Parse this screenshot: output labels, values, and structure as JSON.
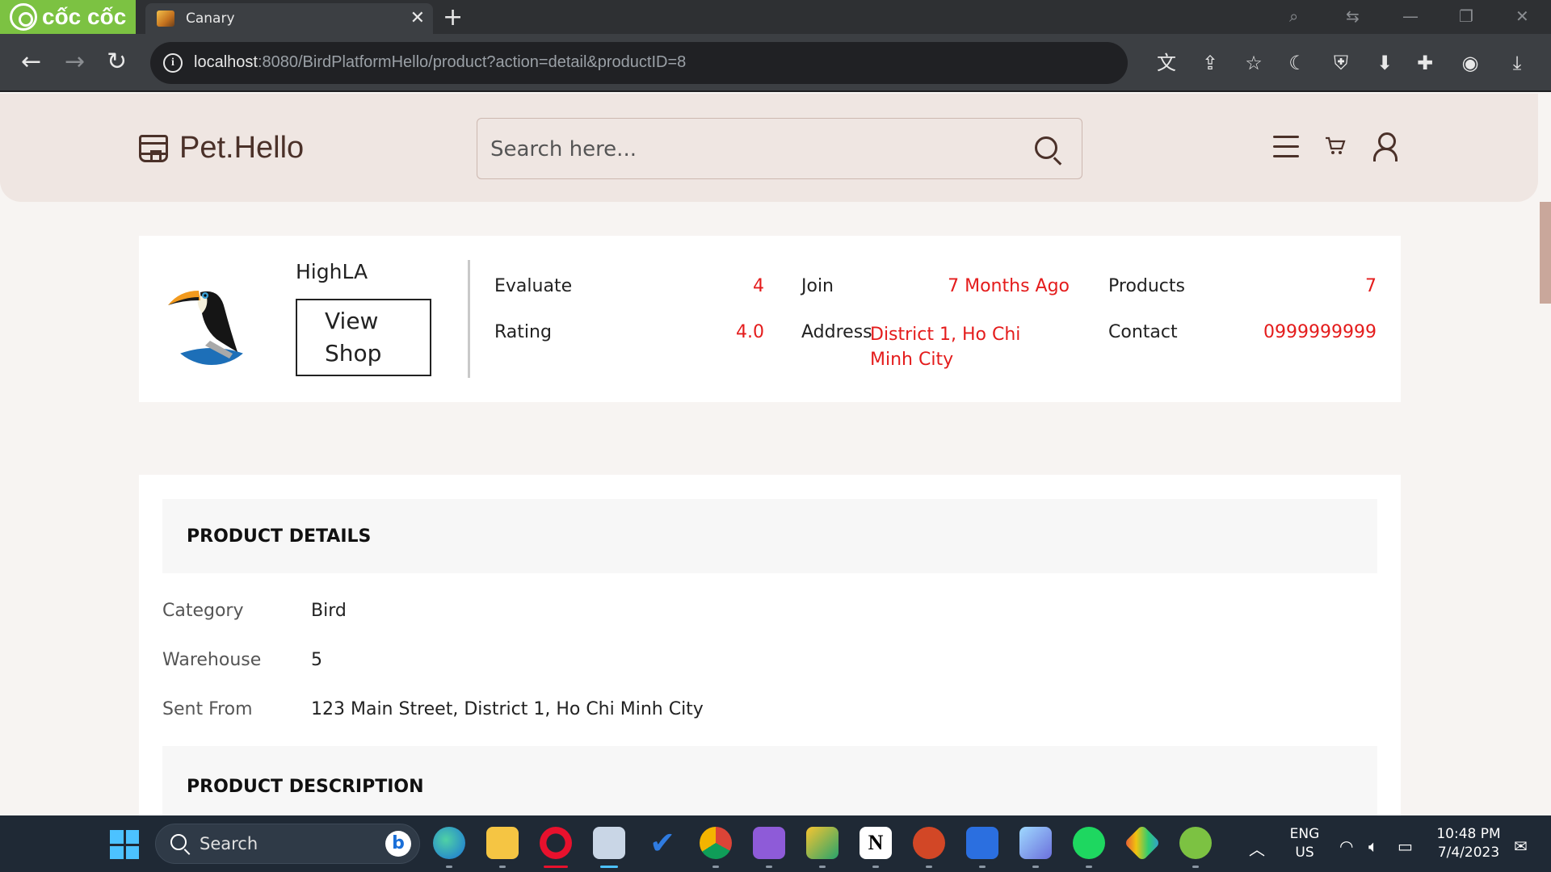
{
  "browser": {
    "brand": "cốc cốc",
    "tab_title": "Canary",
    "url_host": "localhost",
    "url_rest": ":8080/BirdPlatformHello/product?action=detail&productID=8",
    "new_tab_symbol": "+",
    "close_symbol": "✕"
  },
  "site": {
    "name": "Pet.Hello",
    "search_placeholder": "Search here..."
  },
  "shop": {
    "name": "HighLA",
    "view_shop_label": "View Shop",
    "stats": {
      "evaluate_label": "Evaluate",
      "evaluate_value": "4",
      "rating_label": "Rating",
      "rating_value": "4.0",
      "join_label": "Join",
      "join_value": "7 Months Ago",
      "address_label": "Address",
      "address_value": "District 1, Ho Chi Minh City",
      "products_label": "Products",
      "products_value": "7",
      "contact_label": "Contact",
      "contact_value": "0999999999"
    }
  },
  "details": {
    "title": "PRODUCT DETAILS",
    "category_label": "Category",
    "category_value": "Bird",
    "warehouse_label": "Warehouse",
    "warehouse_value": "5",
    "sent_from_label": "Sent From",
    "sent_from_value": "123 Main Street, District 1, Ho Chi Minh City",
    "description_title": "PRODUCT DESCRIPTION"
  },
  "taskbar": {
    "search_label": "Search",
    "lang_line1": "ENG",
    "lang_line2": "US",
    "time": "10:48 PM",
    "date": "7/4/2023"
  },
  "colors": {
    "accent_red": "#e41c1c",
    "brand_brown": "#4b3129",
    "header_bg": "#efe6e2",
    "coccoc_green": "#7cc242"
  }
}
